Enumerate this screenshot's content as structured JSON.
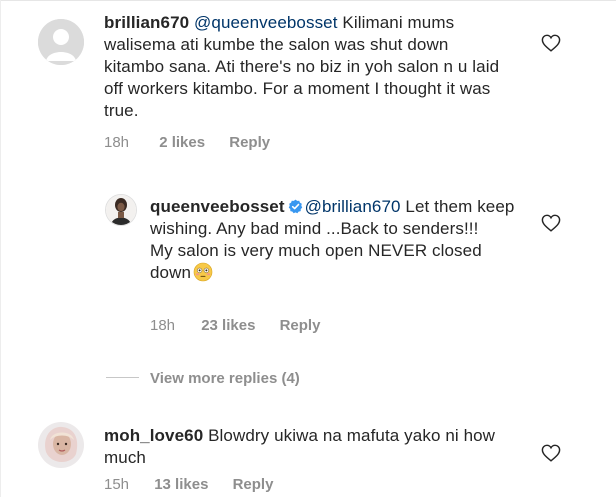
{
  "comments": [
    {
      "username": "brillian670",
      "mention": "@queenveebosset",
      "text": " Kilimani mums walisema ati kumbe the salon was shut down kitambo sana. Ati there's no biz in yoh salon n u laid off workers kitambo. For a moment I thought it was true.",
      "time": "18h",
      "likes": "2 likes",
      "reply": "Reply"
    },
    {
      "username": "queenveebosset",
      "verified_icon": "verified-badge-icon",
      "mention": "@brillian670",
      "text": " Let them keep wishing. Any bad mind ...Back to senders!!!",
      "text2": "My salon is very much open NEVER closed down",
      "emoji_icon": "flushed-face-emoji-icon",
      "time": "18h",
      "likes": "23 likes",
      "reply": "Reply"
    },
    {
      "username": "moh_love60",
      "text": " Blowdry ukiwa na mafuta yako ni how much",
      "time": "15h",
      "likes": "13 likes",
      "reply": "Reply"
    }
  ],
  "view_more_replies": "View more replies (4)",
  "colors": {
    "text": "#262626",
    "mention": "#003569",
    "meta": "#8e8e8e",
    "verified": "#3897f0"
  },
  "icons": {
    "like": "heart-outline-icon",
    "avatar_default": "default-avatar-icon"
  }
}
